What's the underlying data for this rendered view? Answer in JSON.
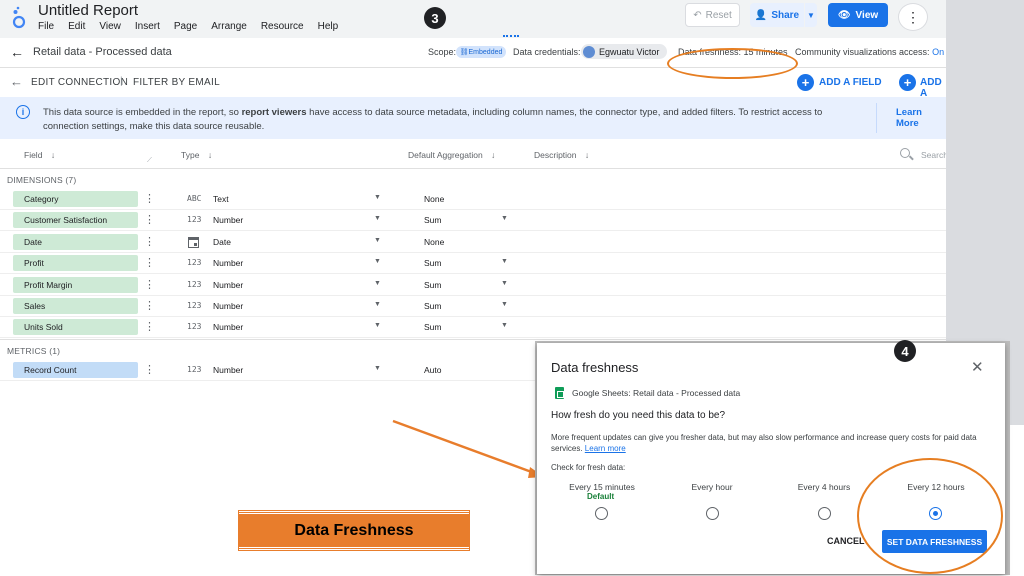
{
  "header": {
    "title": "Untitled Report",
    "menu": [
      "File",
      "Edit",
      "View",
      "Insert",
      "Page",
      "Arrange",
      "Resource",
      "Help"
    ],
    "step_badge": "3",
    "reset_label": "Reset",
    "share_label": "Share",
    "view_label": "View"
  },
  "datasource_bar": {
    "name": "Retail data - Processed data",
    "scope_label": "Scope:",
    "scope_value": "Embedded",
    "credentials_label": "Data credentials:",
    "credentials_user": "Egwuatu Victor",
    "freshness_label": "Data freshness: 15 minutes",
    "community_label": "Community visualizations access:",
    "community_value": "On"
  },
  "edit_row": {
    "edit_connection": "EDIT CONNECTION",
    "separator": "|",
    "filter_by_email": "FILTER BY EMAIL",
    "add_field": "ADD A FIELD",
    "add_other": "ADD A"
  },
  "banner": {
    "text_before": "This data source is embedded in the report, so ",
    "text_bold": "report viewers",
    "text_after": " have access to data source metadata, including column names, the connector type, and added filters. To restrict access to connection settings, make this data source reusable.",
    "learn_more": "Learn More"
  },
  "table": {
    "headers": {
      "field": "Field",
      "type": "Type",
      "default_aggregation": "Default Aggregation",
      "description": "Description",
      "search": "Search"
    },
    "dimensions_title": "DIMENSIONS (7)",
    "metrics_title": "METRICS (1)",
    "dimensions": [
      {
        "name": "Category",
        "type_icon": "ABC",
        "type": "Text",
        "agg": "None",
        "agg_dropdown": false
      },
      {
        "name": "Customer Satisfaction",
        "type_icon": "123",
        "type": "Number",
        "agg": "Sum",
        "agg_dropdown": true
      },
      {
        "name": "Date",
        "type_icon": "calendar",
        "type": "Date",
        "agg": "None",
        "agg_dropdown": false
      },
      {
        "name": "Profit",
        "type_icon": "123",
        "type": "Number",
        "agg": "Sum",
        "agg_dropdown": true
      },
      {
        "name": "Profit Margin",
        "type_icon": "123",
        "type": "Number",
        "agg": "Sum",
        "agg_dropdown": true
      },
      {
        "name": "Sales",
        "type_icon": "123",
        "type": "Number",
        "agg": "Sum",
        "agg_dropdown": true
      },
      {
        "name": "Units Sold",
        "type_icon": "123",
        "type": "Number",
        "agg": "Sum",
        "agg_dropdown": true
      }
    ],
    "metrics": [
      {
        "name": "Record Count",
        "type_icon": "123",
        "type": "Number",
        "agg": "Auto",
        "agg_dropdown": false
      }
    ]
  },
  "dialog": {
    "title": "Data freshness",
    "step_badge": "4",
    "source": "Google Sheets: Retail data - Processed data",
    "question": "How fresh do you need this data to be?",
    "description": "More frequent updates can give you fresher data, but may also slow performance and increase query costs for paid data services.",
    "learn_more": "Learn more",
    "check_label": "Check for fresh data:",
    "options": [
      {
        "label": "Every 15 minutes",
        "selected": false
      },
      {
        "label": "Every hour",
        "selected": false
      },
      {
        "label": "Every 4 hours",
        "selected": false
      },
      {
        "label": "Every 12 hours",
        "selected": true
      }
    ],
    "default_tag": "Default",
    "cancel": "CANCEL",
    "set": "SET DATA FRESHNESS"
  },
  "annotation": {
    "label": "Data Freshness",
    "color": "#e87d2c"
  }
}
